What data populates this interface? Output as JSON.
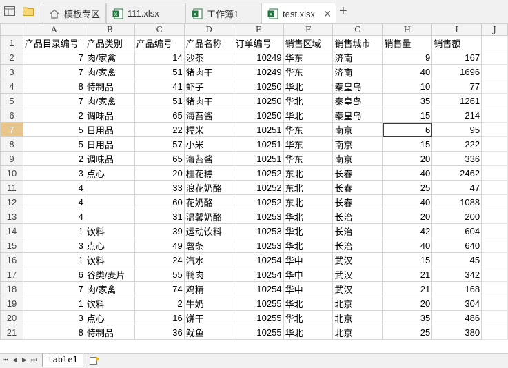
{
  "tabs": [
    {
      "label": "模板专区",
      "icon": "home-icon"
    },
    {
      "label": "111.xlsx",
      "icon": "excel-file-icon"
    },
    {
      "label": "工作簿1",
      "icon": "excel-file-icon"
    },
    {
      "label": "test.xlsx",
      "icon": "excel-file-icon",
      "active": true,
      "close": "✕"
    }
  ],
  "new_tab_label": "+",
  "columns": [
    "A",
    "B",
    "C",
    "D",
    "E",
    "F",
    "G",
    "H",
    "I",
    "J"
  ],
  "selected": {
    "row": 7,
    "col": "H"
  },
  "rows": [
    [
      "产品目录编号",
      "产品类别",
      "产品编号",
      "产品名称",
      "订单编号",
      "销售区域",
      "销售城市",
      "销售量",
      "销售额"
    ],
    [
      "7",
      "肉/家禽",
      "14",
      "沙茶",
      "10249",
      "华东",
      "济南",
      "9",
      "167"
    ],
    [
      "7",
      "肉/家禽",
      "51",
      "猪肉干",
      "10249",
      "华东",
      "济南",
      "40",
      "1696"
    ],
    [
      "8",
      "特制品",
      "41",
      "虾子",
      "10250",
      "华北",
      "秦皇岛",
      "10",
      "77"
    ],
    [
      "7",
      "肉/家禽",
      "51",
      "猪肉干",
      "10250",
      "华北",
      "秦皇岛",
      "35",
      "1261"
    ],
    [
      "2",
      "调味品",
      "65",
      "海苔酱",
      "10250",
      "华北",
      "秦皇岛",
      "15",
      "214"
    ],
    [
      "5",
      "日用品",
      "22",
      "糯米",
      "10251",
      "华东",
      "南京",
      "6",
      "95"
    ],
    [
      "5",
      "日用品",
      "57",
      "小米",
      "10251",
      "华东",
      "南京",
      "15",
      "222"
    ],
    [
      "2",
      "调味品",
      "65",
      "海苔酱",
      "10251",
      "华东",
      "南京",
      "20",
      "336"
    ],
    [
      "3",
      "点心",
      "20",
      "桂花糕",
      "10252",
      "东北",
      "长春",
      "40",
      "2462"
    ],
    [
      "4",
      "",
      "33",
      "浪花奶酪",
      "10252",
      "东北",
      "长春",
      "25",
      "47"
    ],
    [
      "4",
      "",
      "60",
      "花奶酪",
      "10252",
      "东北",
      "长春",
      "40",
      "1088"
    ],
    [
      "4",
      "",
      "31",
      "温馨奶酪",
      "10253",
      "华北",
      "长治",
      "20",
      "200"
    ],
    [
      "1",
      "饮料",
      "39",
      "运动饮料",
      "10253",
      "华北",
      "长治",
      "42",
      "604"
    ],
    [
      "3",
      "点心",
      "49",
      "薯条",
      "10253",
      "华北",
      "长治",
      "40",
      "640"
    ],
    [
      "1",
      "饮料",
      "24",
      "汽水",
      "10254",
      "华中",
      "武汉",
      "15",
      "45"
    ],
    [
      "6",
      "谷类/麦片",
      "55",
      "鸭肉",
      "10254",
      "华中",
      "武汉",
      "21",
      "342"
    ],
    [
      "7",
      "肉/家禽",
      "74",
      "鸡精",
      "10254",
      "华中",
      "武汉",
      "21",
      "168"
    ],
    [
      "1",
      "饮料",
      "2",
      "牛奶",
      "10255",
      "华北",
      "北京",
      "20",
      "304"
    ],
    [
      "3",
      "点心",
      "16",
      "饼干",
      "10255",
      "华北",
      "北京",
      "35",
      "486"
    ],
    [
      "8",
      "特制品",
      "36",
      "鱿鱼",
      "10255",
      "华北",
      "北京",
      "25",
      "380"
    ]
  ],
  "sheet": {
    "name": "table1"
  }
}
